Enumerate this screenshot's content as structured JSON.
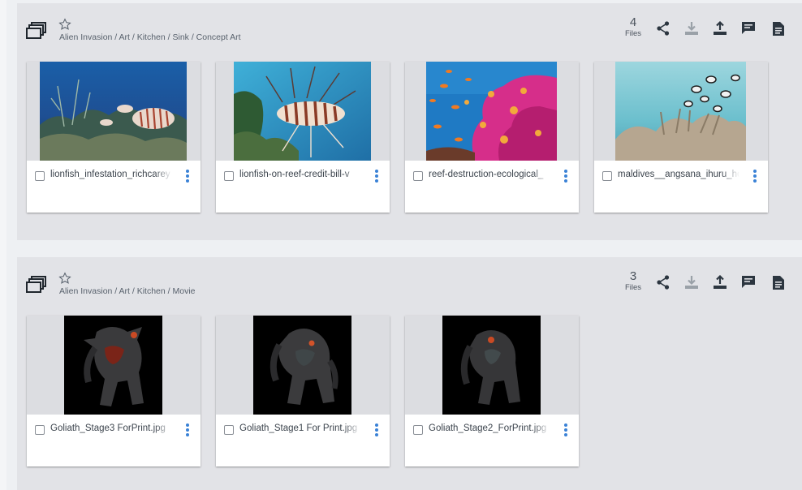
{
  "groups": [
    {
      "id": "g1",
      "breadcrumb": "Alien Invasion / Art / Kitchen / Sink / Concept Art",
      "file_count": "4",
      "files_label": "Files",
      "files": [
        {
          "name": "lionfish_infestation_richcarey",
          "thumb": "reef-lionfish"
        },
        {
          "name": "lionfish-on-reef-credit-bill-v",
          "thumb": "lionfish-closeup"
        },
        {
          "name": "reef-destruction-ecological_",
          "thumb": "coral-fish"
        },
        {
          "name": "maldives__angsana_ihuru_ho",
          "thumb": "maldives-coral"
        }
      ]
    },
    {
      "id": "g2",
      "breadcrumb": "Alien Invasion / Art / Kitchen / Movie",
      "file_count": "3",
      "files_label": "Files",
      "files": [
        {
          "name": "Goliath_Stage3 ForPrint.jpg",
          "thumb": "goliath-monster"
        },
        {
          "name": "Goliath_Stage1 For Print.jpg",
          "thumb": "goliath-monster"
        },
        {
          "name": "Goliath_Stage2_ForPrint.jpg",
          "thumb": "goliath-monster"
        }
      ]
    }
  ],
  "toolbar_icons": [
    "share-icon",
    "download-icon",
    "upload-icon",
    "comment-icon",
    "document-icon",
    "more-icon"
  ],
  "colors": {
    "accent": "#3a82d6",
    "panel": "#e2e3e7",
    "icon": "#2c3640"
  }
}
